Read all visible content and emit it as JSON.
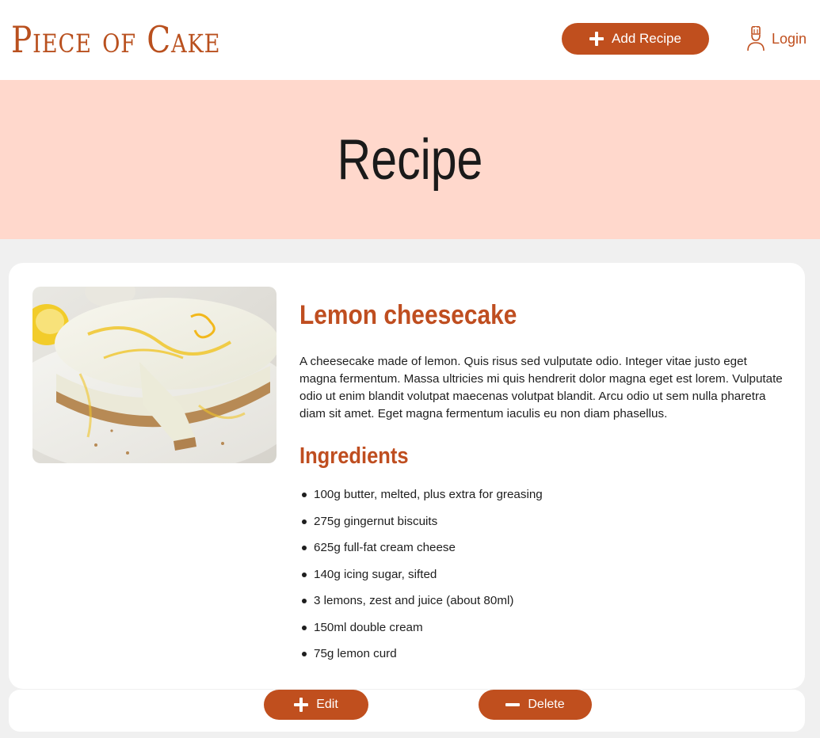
{
  "header": {
    "logo_text": "Piece of Cake",
    "add_recipe_label": "Add Recipe",
    "login_label": "Login"
  },
  "hero": {
    "title": "Recipe"
  },
  "recipe": {
    "title": "Lemon cheesecake",
    "image_alt": "Lemon cheesecake",
    "description": "A cheesecake made of lemon. Quis risus sed vulputate odio. Integer vitae justo eget magna fermentum. Massa ultricies mi quis hendrerit dolor magna eget est lorem. Vulputate odio ut enim blandit volutpat maecenas volutpat blandit. Arcu odio ut sem nulla pharetra diam sit amet. Eget magna fermentum iaculis eu non diam phasellus.",
    "ingredients_heading": "Ingredients",
    "ingredients": [
      "100g butter, melted, plus extra for greasing",
      "275g gingernut biscuits",
      "625g full-fat cream cheese",
      "140g icing sugar, sifted",
      "3 lemons, zest and juice (about 80ml)",
      "150ml double cream",
      "75g lemon curd"
    ]
  },
  "actions": {
    "edit_label": "Edit",
    "delete_label": "Delete"
  },
  "colors": {
    "accent": "#c04f1e",
    "hero_background": "#ffd8cc",
    "page_background": "#f0f0f0"
  },
  "icons": {
    "add": "plus-icon",
    "login": "chef-icon",
    "edit": "plus-icon",
    "delete": "minus-icon"
  }
}
